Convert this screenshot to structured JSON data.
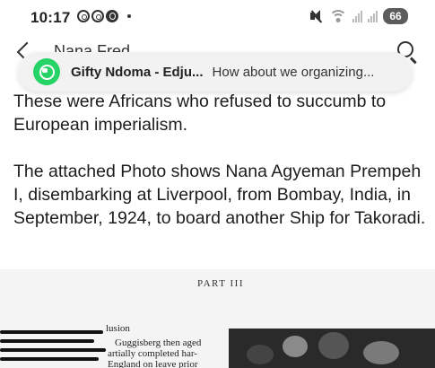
{
  "status_bar": {
    "time": "10:17",
    "battery": "66",
    "icons": [
      "whatsapp-icon",
      "whatsapp-icon",
      "viber-icon",
      "dot-icon",
      "mute-icon",
      "wifi-icon",
      "signal-icon",
      "signal-icon"
    ]
  },
  "app_bar": {
    "title": "Nana Fred"
  },
  "notification": {
    "app_icon": "whatsapp-icon",
    "sender": "Gifty Ndoma - Edju...",
    "preview": "How about we organizing...",
    "accent_color": "#25D366"
  },
  "article": {
    "paragraphs": [
      "These were Africans who refused to succumb to European imperialism.",
      "The attached Photo shows Nana Agyeman Prempeh I, disembarking at Liverpool, from Bombay, India, in September, 1924, to board another Ship for Takoradi."
    ]
  },
  "scan": {
    "part_label": "PART III",
    "lines": [
      "lusion",
      "Guggisberg then aged",
      "artially completed har-",
      "England on leave prior"
    ]
  }
}
